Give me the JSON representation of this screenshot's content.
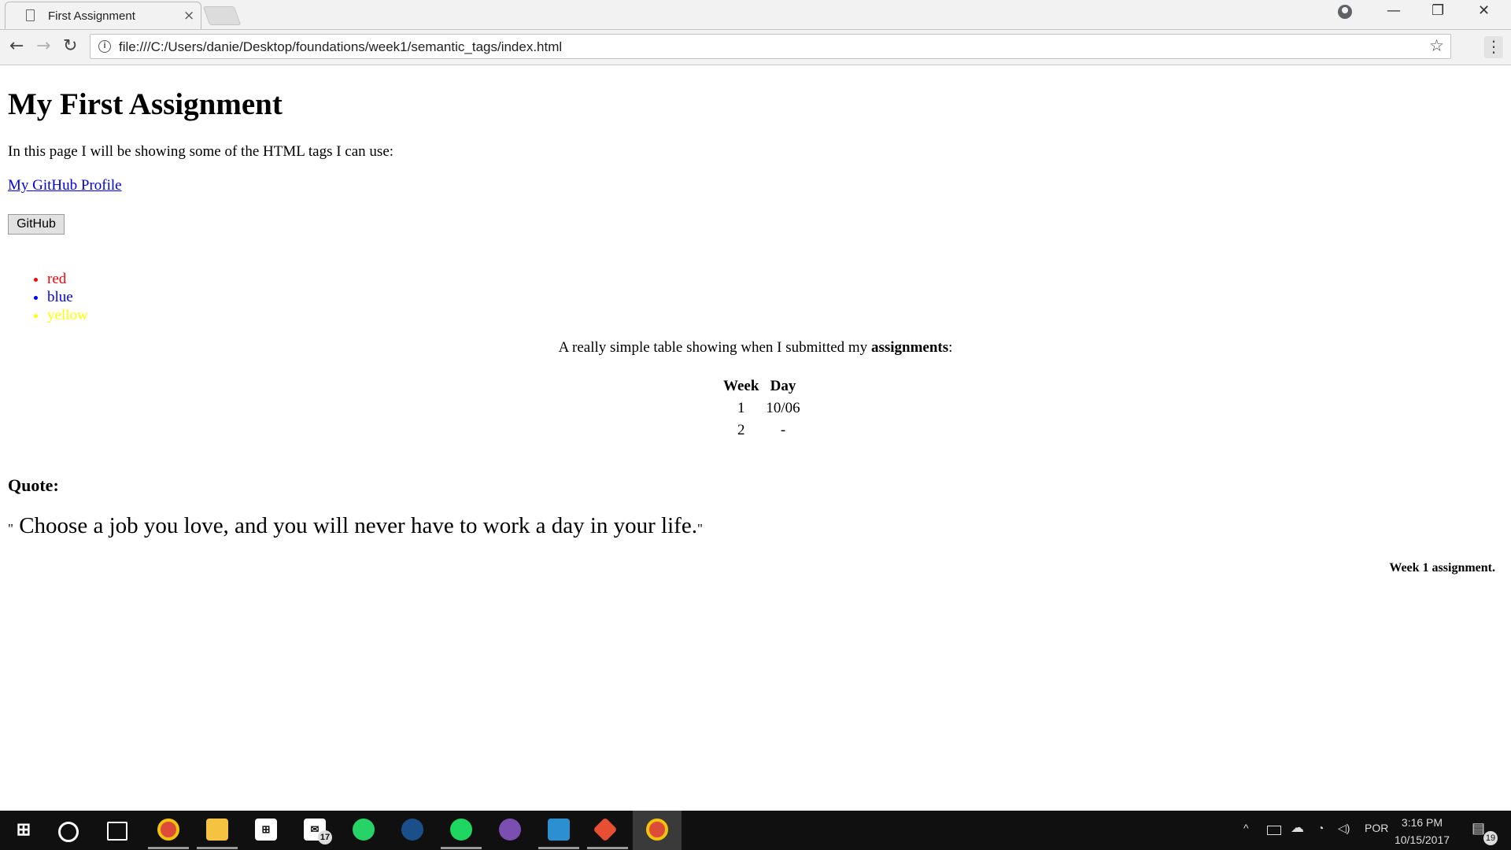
{
  "browser": {
    "tab_title": "First Assignment",
    "tab_close": "×",
    "url": "file:///C:/Users/danie/Desktop/foundations/week1/semantic_tags/index.html",
    "info_glyph": "i",
    "star_glyph": "☆",
    "menu_glyph": "⋮",
    "back_glyph": "←",
    "forward_glyph": "→",
    "reload_glyph": "↻",
    "minimize_glyph": "—",
    "restore_glyph": "❐",
    "close_glyph": "✕"
  },
  "page": {
    "heading": "My First Assignment",
    "intro": "In this page I will be showing some of the HTML tags I can use:",
    "link_text": "My GitHub Profile",
    "button_label": "GitHub",
    "list_items": [
      {
        "label": "red",
        "color": "#ff0000"
      },
      {
        "label": "blue",
        "color": "#0000ff"
      },
      {
        "label": "yellow",
        "color": "#ffff00"
      }
    ],
    "caption_before": "A really simple table showing when I submitted my ",
    "caption_bold": "assignments",
    "caption_after": ":",
    "table": {
      "headers": [
        "Week",
        "Day"
      ],
      "rows": [
        [
          "1",
          "10/06"
        ],
        [
          "2",
          "-"
        ]
      ]
    },
    "quote_label": "Quote:",
    "quote_open": "\"",
    "quote_text": " Choose a job you love, and you will never have to work a day in your life.",
    "quote_close": "\"",
    "footer": "Week 1 assignment."
  },
  "taskbar": {
    "mail_badge": "17",
    "language": "POR",
    "time": "3:16 PM",
    "date": "10/15/2017",
    "notification_count": "19",
    "apps": [
      "windows-start",
      "cortana",
      "task-view",
      "chrome",
      "file-explorer",
      "store",
      "mail",
      "whatsapp",
      "steam",
      "spotify",
      "github-desktop",
      "brackets",
      "git",
      "chrome-active"
    ]
  }
}
